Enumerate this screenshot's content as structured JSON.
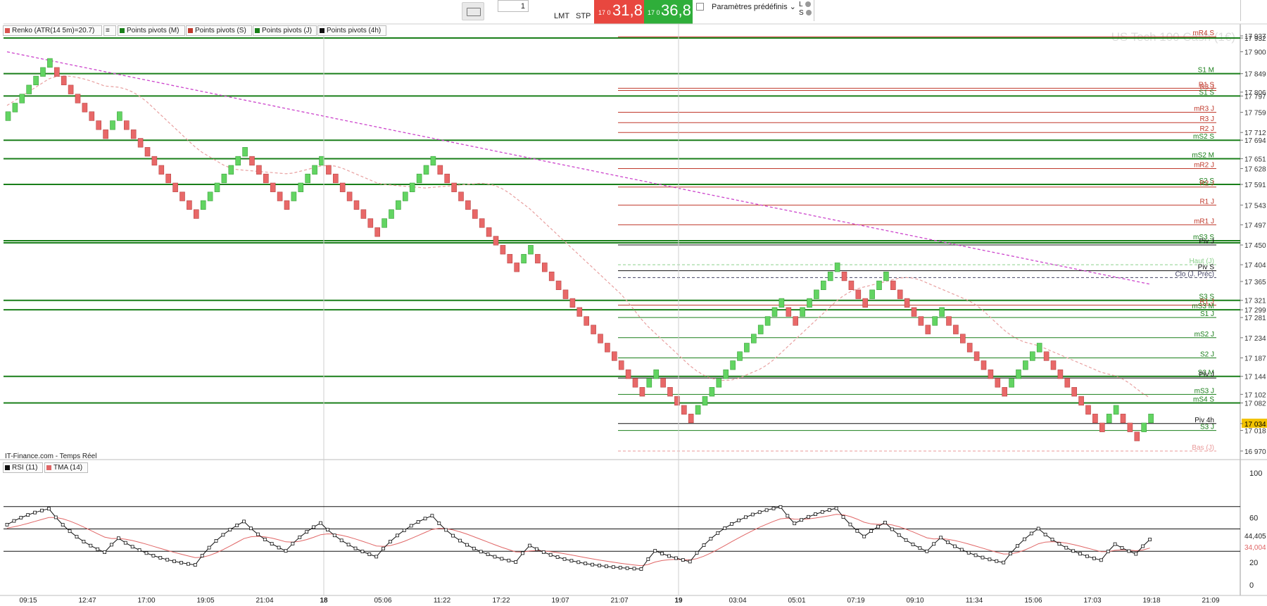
{
  "toolbar": {
    "quantity": "1",
    "lmt_label": "LMT",
    "stp_label": "STP",
    "sell_small": "17 0",
    "sell_big": "31,8",
    "buy_small": "17 0",
    "buy_big": "36,8",
    "preset_label": "Paramètres prédéfinis",
    "l_label": "L",
    "s_label": "S",
    "sell_color": "#e8473f",
    "buy_color": "#2fae3a"
  },
  "legend": [
    {
      "label": "Renko (ATR(14 5m)=20.7)",
      "swatch": "#d9534f"
    },
    {
      "label": "Points pivots (M)",
      "swatch": "#1a7f1a"
    },
    {
      "label": "Points pivots (S)",
      "swatch": "#c0392b"
    },
    {
      "label": "Points pivots (J)",
      "swatch": "#1a7f1a"
    },
    {
      "label": "Points pivots (4h)",
      "swatch": "#111111"
    }
  ],
  "footer_text": "IT-Finance.com - Temps Réel",
  "rsi_legend": [
    {
      "label": "RSI (11)",
      "swatch": "#111111"
    },
    {
      "label": "TMA (14)",
      "swatch": "#e06666"
    }
  ],
  "chart_data": {
    "type": "renko",
    "title": "US Tech 100 Cash (1€)",
    "ylim": [
      16955,
      17955
    ],
    "price_ticks": [
      "17 937",
      "17 932",
      "17 900",
      "17 849",
      "17 806",
      "17 797",
      "17 759",
      "17 712",
      "17 694",
      "17 651",
      "17 628",
      "17 591",
      "17 543",
      "17 497",
      "17 450",
      "17 404",
      "17 365",
      "17 321",
      "17 299",
      "17 281",
      "17 234",
      "17 187",
      "17 144",
      "17 102",
      "17 082",
      "17 034",
      "17 018",
      "16 970"
    ],
    "current_price": "17 034",
    "brick_size": 20.7,
    "x_labels": [
      "09:15",
      "12:47",
      "17:00",
      "19:05",
      "21:04",
      "18",
      "05:06",
      "11:22",
      "17:22",
      "19:07",
      "21:07",
      "19",
      "03:04",
      "05:01",
      "07:19",
      "09:10",
      "11:34",
      "15:06",
      "17:03",
      "19:18",
      "21:09"
    ],
    "bricks": [
      17750,
      17770,
      17791,
      17812,
      17833,
      17853,
      17874,
      17853,
      17833,
      17812,
      17791,
      17770,
      17750,
      17729,
      17708,
      17729,
      17750,
      17729,
      17708,
      17688,
      17667,
      17646,
      17625,
      17605,
      17584,
      17563,
      17543,
      17522,
      17543,
      17563,
      17584,
      17605,
      17625,
      17646,
      17667,
      17646,
      17625,
      17605,
      17584,
      17563,
      17543,
      17563,
      17584,
      17605,
      17625,
      17646,
      17625,
      17605,
      17584,
      17563,
      17543,
      17522,
      17501,
      17480,
      17501,
      17522,
      17543,
      17563,
      17584,
      17605,
      17625,
      17646,
      17625,
      17605,
      17584,
      17563,
      17543,
      17522,
      17501,
      17480,
      17460,
      17439,
      17418,
      17398,
      17418,
      17439,
      17418,
      17398,
      17377,
      17356,
      17335,
      17315,
      17294,
      17273,
      17253,
      17232,
      17211,
      17191,
      17170,
      17149,
      17129,
      17108,
      17129,
      17149,
      17129,
      17108,
      17087,
      17066,
      17046,
      17066,
      17087,
      17108,
      17129,
      17149,
      17170,
      17191,
      17211,
      17232,
      17253,
      17273,
      17294,
      17315,
      17294,
      17273,
      17294,
      17315,
      17335,
      17356,
      17377,
      17398,
      17377,
      17356,
      17335,
      17315,
      17335,
      17356,
      17377,
      17356,
      17335,
      17315,
      17294,
      17273,
      17253,
      17273,
      17294,
      17273,
      17253,
      17232,
      17211,
      17191,
      17170,
      17149,
      17129,
      17108,
      17129,
      17149,
      17170,
      17191,
      17211,
      17191,
      17170,
      17149,
      17129,
      17108,
      17087,
      17066,
      17046,
      17025,
      17046,
      17066,
      17046,
      17025,
      17004,
      17025,
      17046
    ],
    "pivot_levels": [
      {
        "label": "mR4 S",
        "value": 17935,
        "color": "#c0392b"
      },
      {
        "label": "S1 M",
        "value": 17849,
        "color": "#1a7f1a"
      },
      {
        "label": "R1 S",
        "value": 17815,
        "color": "#c0392b"
      },
      {
        "label": "R3 J",
        "value": 17810,
        "color": "#c0392b"
      },
      {
        "label": "S1 S",
        "value": 17797,
        "color": "#1a7f1a"
      },
      {
        "label": "mR3 J",
        "value": 17759,
        "color": "#c0392b"
      },
      {
        "label": "R3 J",
        "value": 17735,
        "color": "#c0392b"
      },
      {
        "label": "R2 J",
        "value": 17712,
        "color": "#c0392b"
      },
      {
        "label": "mS2 S",
        "value": 17694,
        "color": "#1a7f1a"
      },
      {
        "label": "mS2 M",
        "value": 17651,
        "color": "#1a7f1a"
      },
      {
        "label": "mR2 J",
        "value": 17628,
        "color": "#c0392b"
      },
      {
        "label": "S2 S",
        "value": 17591,
        "color": "#1a7f1a"
      },
      {
        "label": "R2 J",
        "value": 17585,
        "color": "#c0392b"
      },
      {
        "label": "R1 J",
        "value": 17543,
        "color": "#c0392b"
      },
      {
        "label": "mR1 J",
        "value": 17497,
        "color": "#c0392b"
      },
      {
        "label": "mS3 S",
        "value": 17460,
        "color": "#1a7f1a"
      },
      {
        "label": "Piv J",
        "value": 17450,
        "color": "#111111"
      },
      {
        "label": "Haut (J)",
        "value": 17404,
        "color": "#8bd08b"
      },
      {
        "label": "Piv S",
        "value": 17390,
        "color": "#111111"
      },
      {
        "label": "Clo (J. Préc)",
        "value": 17374,
        "color": "#444466"
      },
      {
        "label": "S3 S",
        "value": 17321,
        "color": "#1a7f1a"
      },
      {
        "label": "R1 J",
        "value": 17310,
        "color": "#c0392b"
      },
      {
        "label": "mS3 M",
        "value": 17299,
        "color": "#1a7f1a"
      },
      {
        "label": "S1 J",
        "value": 17281,
        "color": "#1a7f1a"
      },
      {
        "label": "mS2 J",
        "value": 17234,
        "color": "#1a7f1a"
      },
      {
        "label": "S2 J",
        "value": 17187,
        "color": "#1a7f1a"
      },
      {
        "label": "S3 M",
        "value": 17144,
        "color": "#1a7f1a"
      },
      {
        "label": "Piv J",
        "value": 17140,
        "color": "#111111"
      },
      {
        "label": "mS3 J",
        "value": 17102,
        "color": "#1a7f1a"
      },
      {
        "label": "mS4 S",
        "value": 17082,
        "color": "#1a7f1a"
      },
      {
        "label": "Piv 4h",
        "value": 17034,
        "color": "#111111"
      },
      {
        "label": "S3 J",
        "value": 17018,
        "color": "#1a7f1a"
      },
      {
        "label": "Bas (J)",
        "value": 16970,
        "color": "#e99a9a"
      }
    ],
    "full_width_levels": [
      17932,
      17849,
      17797,
      17694,
      17651,
      17591,
      17460,
      17455,
      17321,
      17299,
      17144,
      17082
    ],
    "rsi": {
      "ticks": [
        "100",
        "60",
        "20",
        "0"
      ],
      "levels": [
        70,
        50,
        30
      ],
      "ylim": [
        0,
        100
      ],
      "last_rsi": "44,405",
      "last_tma": "34,004"
    }
  }
}
